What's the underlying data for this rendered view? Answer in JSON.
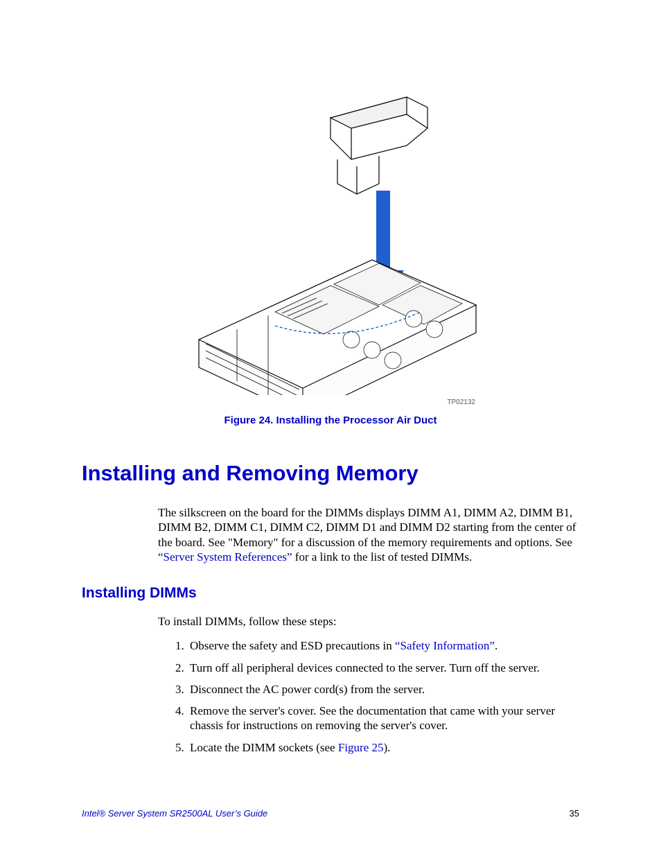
{
  "figure": {
    "image_code": "TP02132",
    "caption": "Figure 24. Installing the Processor Air Duct"
  },
  "section": {
    "title": "Installing and Removing Memory",
    "intro_pre": "The silkscreen on the board for the DIMMs displays DIMM A1, DIMM A2, DIMM B1, DIMM B2, DIMM C1, DIMM C2, DIMM D1 and DIMM D2 starting from the center of the board. See \"Memory\" for a discussion of the memory requirements and options. See ",
    "intro_link": "“Server System References”",
    "intro_post": " for a link to the list of tested DIMMs."
  },
  "subsection": {
    "title": "Installing DIMMs",
    "lead": "To install DIMMs, follow these steps:",
    "steps": {
      "s1_pre": "Observe the safety and ESD precautions in ",
      "s1_link": "“Safety Information”",
      "s1_post": ".",
      "s2": "Turn off all peripheral devices connected to the server. Turn off the server.",
      "s3": "Disconnect the AC power cord(s) from the server.",
      "s4": "Remove the server's cover. See the documentation that came with your server chassis for instructions on removing the server's cover.",
      "s5_pre": "Locate the DIMM sockets (see ",
      "s5_link": "Figure 25",
      "s5_post": ")."
    }
  },
  "footer": {
    "doc_title": "Intel® Server System SR2500AL User’s Guide",
    "page_number": "35"
  }
}
